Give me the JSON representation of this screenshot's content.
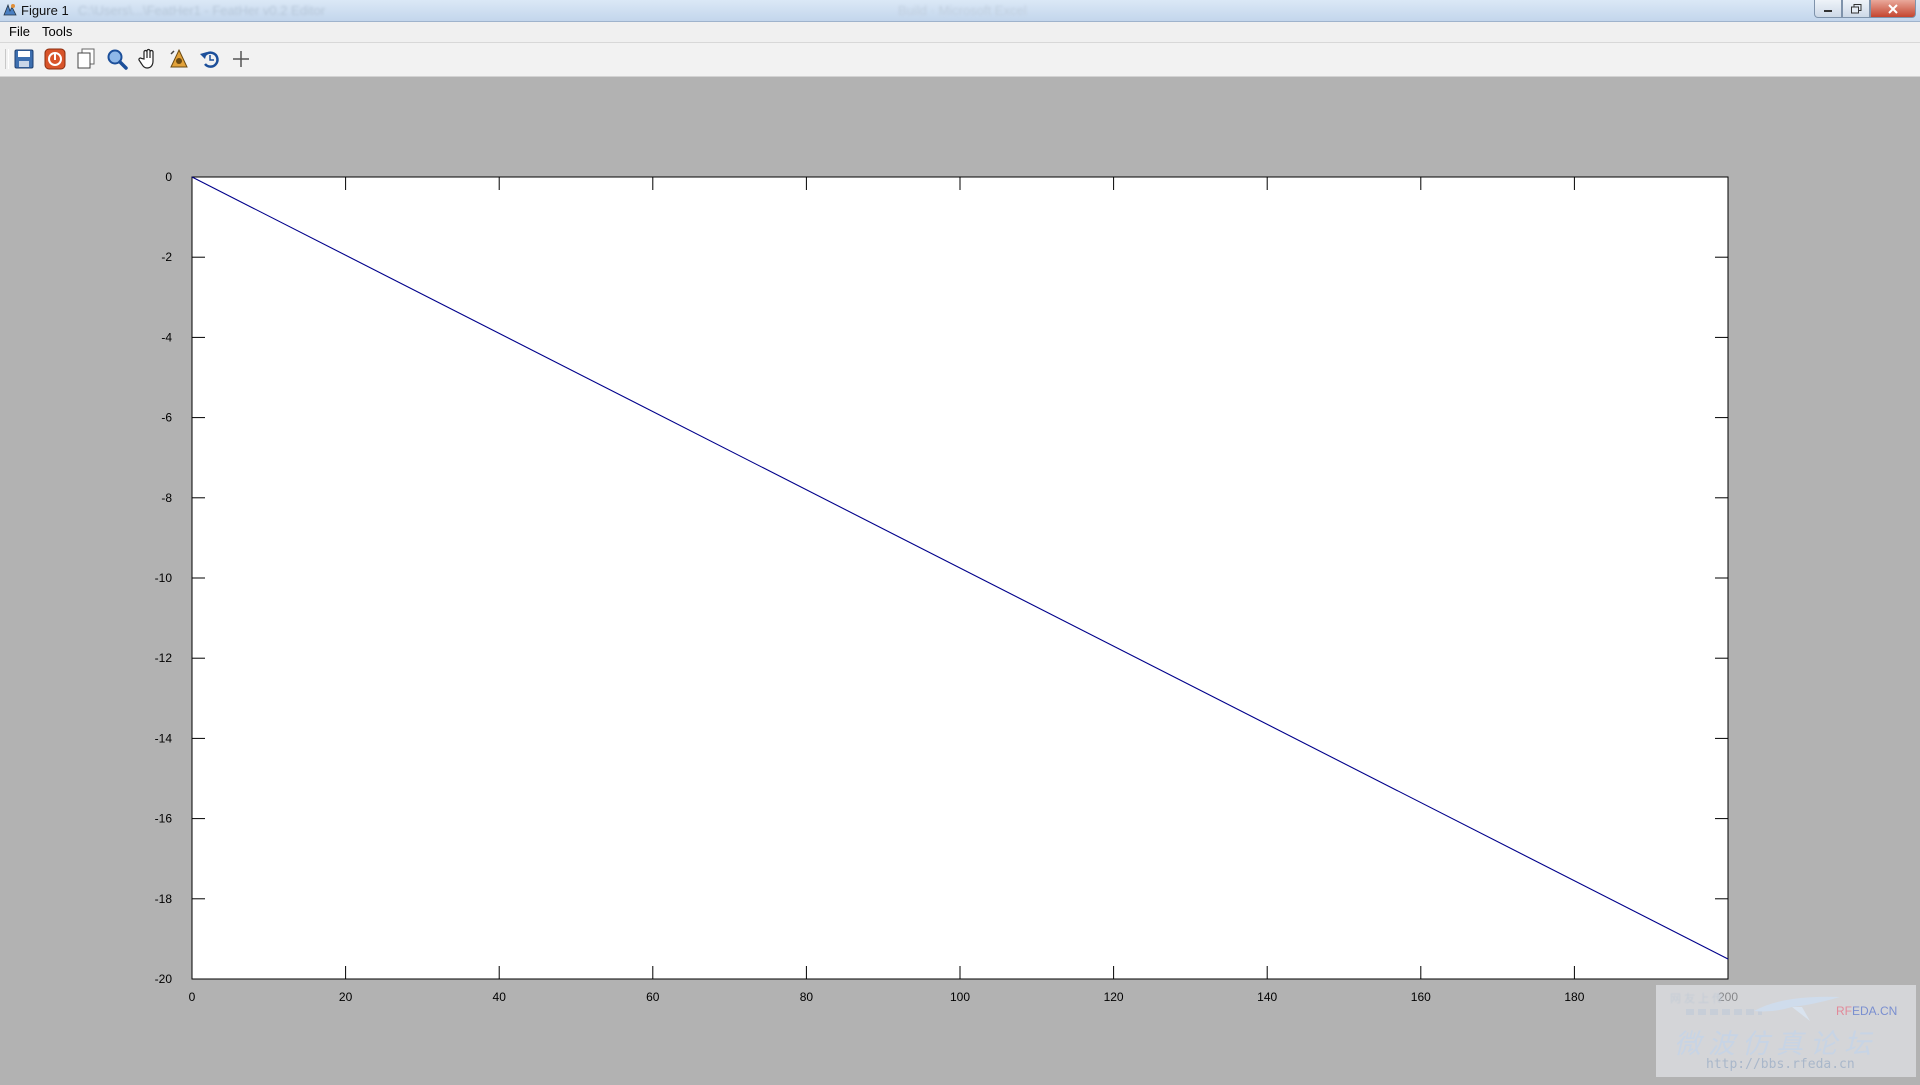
{
  "window": {
    "title": "Figure 1",
    "controls": [
      "minimize",
      "restore",
      "close"
    ]
  },
  "menu": {
    "file": "File",
    "tools": "Tools"
  },
  "toolbar": {
    "buttons": [
      {
        "name": "save-icon"
      },
      {
        "name": "stop-icon"
      },
      {
        "name": "copy-icon"
      },
      {
        "name": "zoom-icon"
      },
      {
        "name": "pan-icon"
      },
      {
        "name": "rotate-3d-icon"
      },
      {
        "name": "reset-view-icon"
      },
      {
        "name": "crosshair-icon"
      }
    ]
  },
  "chart_data": {
    "type": "line",
    "title": "",
    "xlabel": "",
    "ylabel": "",
    "xlim": [
      0,
      200
    ],
    "ylim": [
      -20,
      0
    ],
    "xticks": [
      0,
      20,
      40,
      60,
      80,
      100,
      120,
      140,
      160,
      180,
      200
    ],
    "yticks": [
      0,
      -2,
      -4,
      -6,
      -8,
      -10,
      -12,
      -14,
      -16,
      -18,
      -20
    ],
    "grid": false,
    "series": [
      {
        "color": "#00008b",
        "x": [
          0,
          200
        ],
        "y": [
          0,
          -19.5
        ]
      }
    ]
  },
  "watermark": {
    "brand_rf": "RF",
    "brand_rest": "EDA.CN",
    "chinese": "微波仿真论坛",
    "url": "http://bbs.rfeda.cn"
  }
}
